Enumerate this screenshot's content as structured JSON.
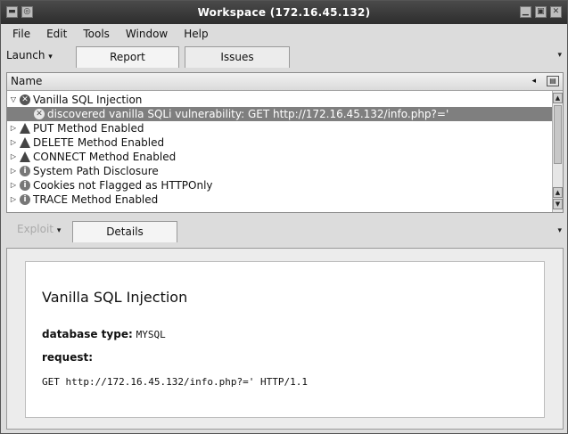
{
  "window": {
    "title": "Workspace (172.16.45.132)"
  },
  "menu": [
    "File",
    "Edit",
    "Tools",
    "Window",
    "Help"
  ],
  "toolbar": {
    "launch_label": "Launch",
    "tabs": [
      "Report",
      "Issues"
    ]
  },
  "tree": {
    "column_header": "Name",
    "rows": [
      {
        "text": "Vanilla SQL Injection",
        "icon": "error-icon",
        "expander": "expanded"
      },
      {
        "text": "discovered vanilla SQLi vulnerability: GET http://172.16.45.132/info.php?='",
        "icon": "error-icon",
        "expander": "none",
        "selected": true
      },
      {
        "text": "PUT Method Enabled",
        "icon": "warning-icon",
        "expander": "collapsed"
      },
      {
        "text": "DELETE Method Enabled",
        "icon": "warning-icon",
        "expander": "collapsed"
      },
      {
        "text": "CONNECT Method Enabled",
        "icon": "warning-icon",
        "expander": "collapsed"
      },
      {
        "text": "System Path Disclosure",
        "icon": "info-icon",
        "expander": "collapsed"
      },
      {
        "text": "Cookies not Flagged as HTTPOnly",
        "icon": "info-icon",
        "expander": "collapsed"
      },
      {
        "text": "TRACE Method Enabled",
        "icon": "info-icon",
        "expander": "collapsed"
      }
    ]
  },
  "lower": {
    "exploit_label": "Exploit",
    "tab_label": "Details"
  },
  "details": {
    "title": "Vanilla SQL Injection",
    "db_type_label": "database type:",
    "db_type_value": "MYSQL",
    "request_label": "request:",
    "request_value": "GET http://172.16.45.132/info.php?=' HTTP/1.1"
  },
  "colors": {
    "titlebar": "#2d2d2d",
    "selection": "#7f7f7f",
    "window_bg": "#dcdcdc"
  }
}
